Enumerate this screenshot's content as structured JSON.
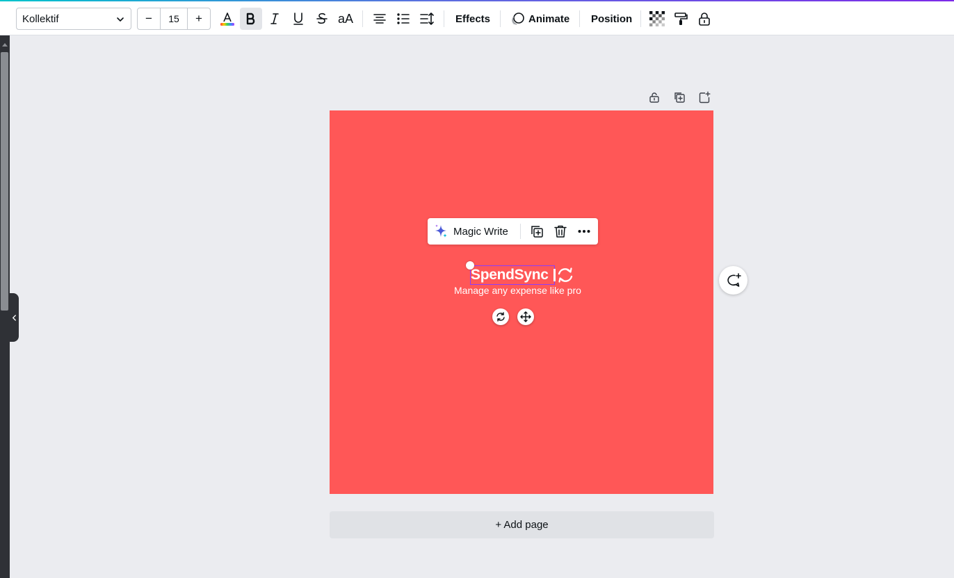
{
  "toolbar": {
    "font_family": "Kollektif",
    "font_size": "15",
    "decrease_label": "−",
    "increase_label": "+",
    "case_label": "aA",
    "effects_label": "Effects",
    "animate_label": "Animate",
    "position_label": "Position",
    "text_color_gradient": [
      "#ff3b3b",
      "#ffcc00",
      "#3ad45a",
      "#3b8bff",
      "#b03bff"
    ]
  },
  "canvas": {
    "background_color": "#ff5757",
    "brand_title": "SpendSync",
    "tagline": "Manage any expense like pro",
    "selection_color": "#8b3dff"
  },
  "context_menu": {
    "magic_write_label": "Magic Write"
  },
  "add_page_label": "+ Add page",
  "icons": {
    "font_dropdown": "chevron-down-icon",
    "text_color": "text-color-icon",
    "bold": "bold-icon",
    "italic": "italic-icon",
    "underline": "underline-icon",
    "strikethrough": "strikethrough-icon",
    "align": "align-center-icon",
    "list": "bullet-list-icon",
    "spacing": "line-spacing-icon",
    "transparency": "transparency-icon",
    "style_painter": "paint-roller-icon",
    "lock": "lock-icon",
    "page_lock": "lock-icon",
    "page_duplicate": "duplicate-icon",
    "page_add": "add-page-icon",
    "magic": "sparkle-icon",
    "copy": "duplicate-icon",
    "delete": "trash-icon",
    "more": "more-icon",
    "rotate": "rotate-icon",
    "move": "move-icon",
    "comment": "comment-add-icon",
    "collapse": "chevron-left-icon"
  }
}
